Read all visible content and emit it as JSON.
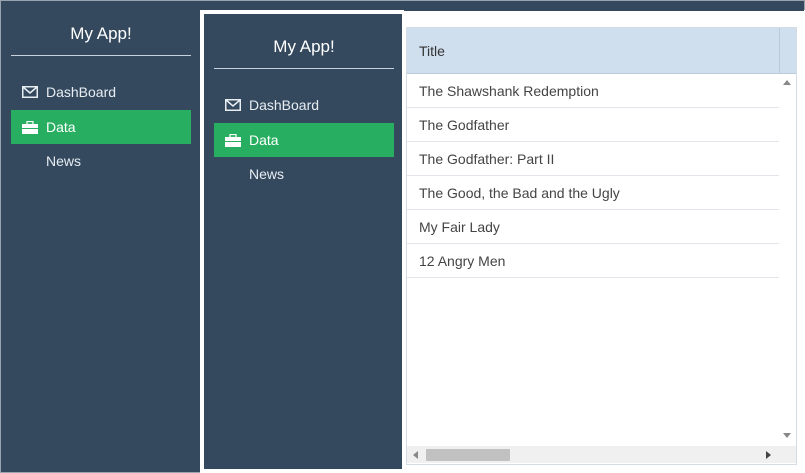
{
  "outer_sidebar": {
    "title": "My App!",
    "items": [
      {
        "label": "DashBoard",
        "icon": "envelope-icon",
        "active": false
      },
      {
        "label": "Data",
        "icon": "briefcase-icon",
        "active": true
      },
      {
        "label": "News",
        "icon": "",
        "active": false
      }
    ]
  },
  "inner_sidebar": {
    "title": "My App!",
    "items": [
      {
        "label": "DashBoard",
        "icon": "envelope-icon",
        "active": false
      },
      {
        "label": "Data",
        "icon": "briefcase-icon",
        "active": true
      },
      {
        "label": "News",
        "icon": "",
        "active": false
      }
    ]
  },
  "grid": {
    "columns": [
      "Title"
    ],
    "rows": [
      "The Shawshank Redemption",
      "The Godfather",
      "The Godfather: Part II",
      "The Good, the Bad and the Ugly",
      "My Fair Lady",
      "12 Angry Men"
    ]
  },
  "colors": {
    "sidebar_bg": "#34495e",
    "active_item": "#27ae60",
    "grid_header": "#d0dfee"
  }
}
